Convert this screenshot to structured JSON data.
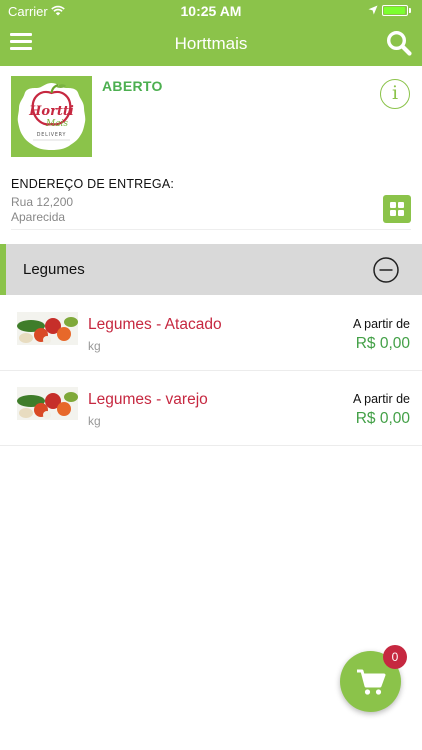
{
  "status_bar": {
    "carrier": "Carrier",
    "time": "10:25 AM",
    "battery_level": 0.95
  },
  "nav": {
    "title": "Horttmais",
    "menu_icon": "hamburger-menu-icon",
    "search_icon": "search-icon"
  },
  "store": {
    "logo_text": "Hortti Mais",
    "logo_subtext": "DELIVERY",
    "status": "ABERTO",
    "info_icon": "info-icon"
  },
  "address": {
    "label": "ENDEREÇO DE ENTREGA:",
    "line1": "Rua 12,200",
    "line2": "Aparecida",
    "grid_icon": "grid-icon"
  },
  "category": {
    "title": "Legumes",
    "collapse_icon": "minus-circle-icon"
  },
  "products": [
    {
      "name": "Legumes - Atacado",
      "unit": "kg",
      "from_label": "A partir de",
      "price": "R$ 0,00"
    },
    {
      "name": "Legumes - varejo",
      "unit": "kg",
      "from_label": "A partir de",
      "price": "R$ 0,00"
    }
  ],
  "cart": {
    "icon": "cart-icon",
    "count": "0"
  },
  "colors": {
    "brand_green": "#8bc34a",
    "price_green": "#43a047",
    "product_red": "#c62840",
    "category_bg": "#d9d9d9"
  }
}
